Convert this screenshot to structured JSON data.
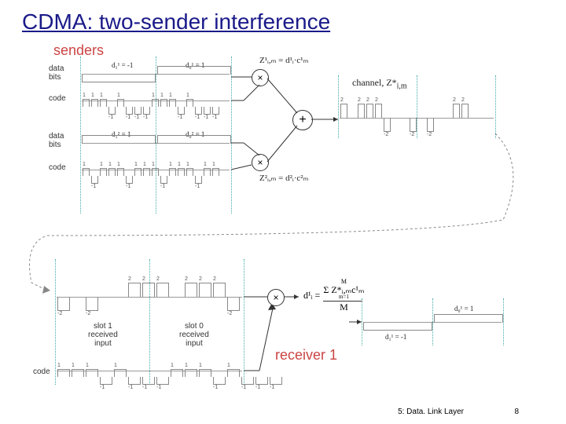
{
  "title": "CDMA: two-sender interference",
  "sections": {
    "senders_label": "senders",
    "receiver_label": "receiver 1"
  },
  "labels": {
    "data_bits": "data\nbits",
    "code": "code",
    "channel": "channel, Z*",
    "channel_sub": "i,m",
    "slot1": "slot 1\nreceived\ninput",
    "slot0": "slot 0\nreceived\ninput"
  },
  "sender1": {
    "d0": "d₀¹ = 1",
    "d1": "d₁¹ = -1",
    "z": "Z¹ᵢ,ₘ = d¹ᵢ·c¹ₘ",
    "code": [
      1,
      1,
      1,
      -1,
      1,
      -1,
      -1,
      -1,
      1,
      1,
      1,
      -1,
      1,
      -1,
      -1,
      -1
    ],
    "data_top": [
      0,
      0,
      0,
      0,
      0,
      0,
      0,
      0,
      -1,
      -1,
      -1,
      -1,
      -1,
      -1,
      -1,
      -1
    ]
  },
  "sender2": {
    "d0": "d₀² = 1",
    "d1": "d₁² = 1",
    "z": "Z²ᵢ,ₘ = d²ᵢ·c²ₘ",
    "code": [
      1,
      -1,
      1,
      1,
      1,
      -1,
      1,
      1,
      1,
      -1,
      1,
      1,
      1,
      -1,
      1,
      1
    ],
    "data_top": [
      0,
      0,
      0,
      0,
      0,
      0,
      0,
      0,
      0,
      0,
      0,
      0,
      0,
      0,
      0,
      0
    ]
  },
  "channel_seq": [
    2,
    0,
    2,
    2,
    2,
    -2,
    0,
    0,
    -2,
    0,
    -2,
    0,
    0,
    2,
    2
  ],
  "receiver": {
    "rec_seq": [
      -2,
      0,
      -2,
      0,
      0,
      2,
      2,
      2,
      0,
      2,
      2,
      2,
      -2,
      0,
      0
    ],
    "code": [
      1,
      1,
      1,
      -1,
      1,
      -1,
      -1,
      -1,
      1,
      1,
      1,
      -1,
      1,
      -1,
      -1,
      -1
    ],
    "d1": "d₁¹ = -1",
    "d0": "d₀¹ = 1",
    "formula_top": "M",
    "formula_sum": "Σ Z*ᵢ,ₘc¹ₘ",
    "formula_sumidx": "m=1",
    "formula_lhs": "d¹ᵢ =",
    "formula_bot": "M"
  },
  "footer": {
    "left": "5: Data. Link Layer",
    "right": "8"
  }
}
